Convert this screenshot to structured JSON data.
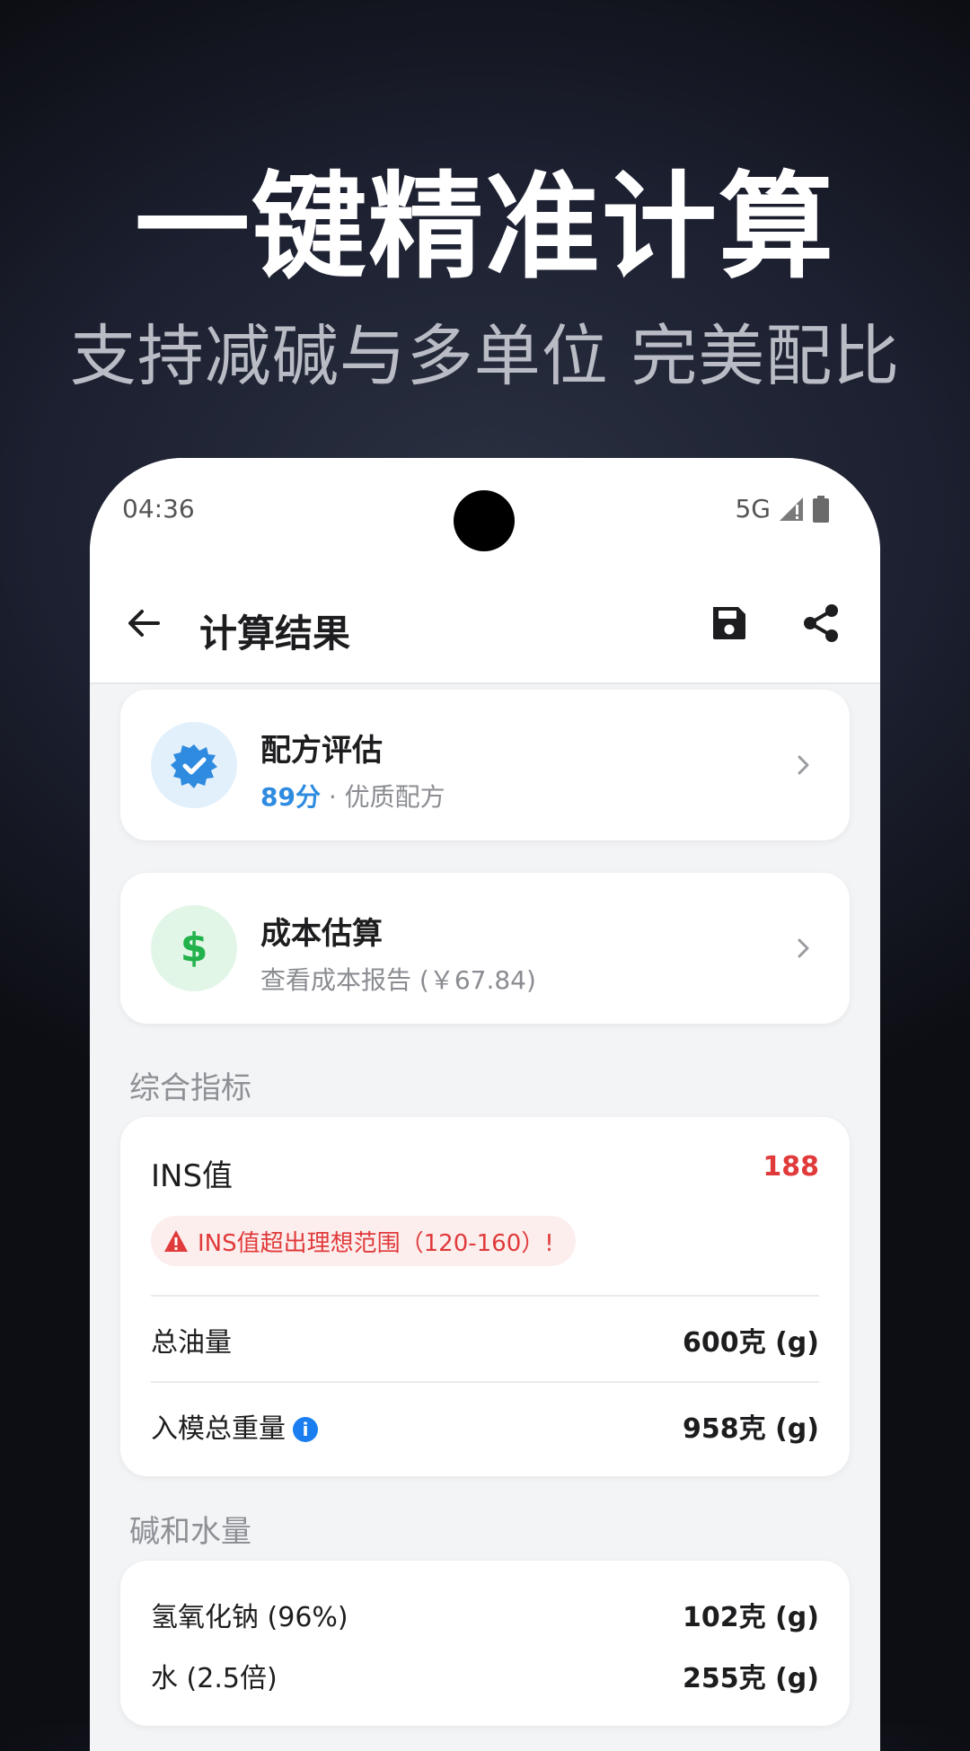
{
  "hero": {
    "title": "一键精准计算",
    "subtitle": "支持减碱与多单位 完美配比"
  },
  "status_bar": {
    "time": "04:36",
    "network": "5G"
  },
  "appbar": {
    "title": "计算结果"
  },
  "cards": {
    "evaluation": {
      "title": "配方评估",
      "score": "89分",
      "separator": " · ",
      "label": "优质配方",
      "icon": "verified-badge-icon",
      "color": "#2e8be0"
    },
    "cost": {
      "title": "成本估算",
      "subtitle": "查看成本报告 (￥67.84)",
      "icon": "dollar-icon",
      "color": "#22b24c"
    }
  },
  "metrics": {
    "section_title": "综合指标",
    "ins_label": "INS值",
    "ins_value": "188",
    "ins_warning": "INS值超出理想范围（120-160）!",
    "total_oil_label": "总油量",
    "total_oil_value": "600克 (g)",
    "mold_weight_label": "入模总重量",
    "mold_weight_value": "958克 (g)"
  },
  "lye_water": {
    "section_title": "碱和水量",
    "naoh_label": "氢氧化钠 (96%)",
    "naoh_value": "102克 (g)",
    "water_label": "水 (2.5倍)",
    "water_value": "255克 (g)"
  },
  "colors": {
    "accent_blue": "#2e8be0",
    "warning_red": "#e03a3a",
    "success_green": "#22b24c"
  }
}
